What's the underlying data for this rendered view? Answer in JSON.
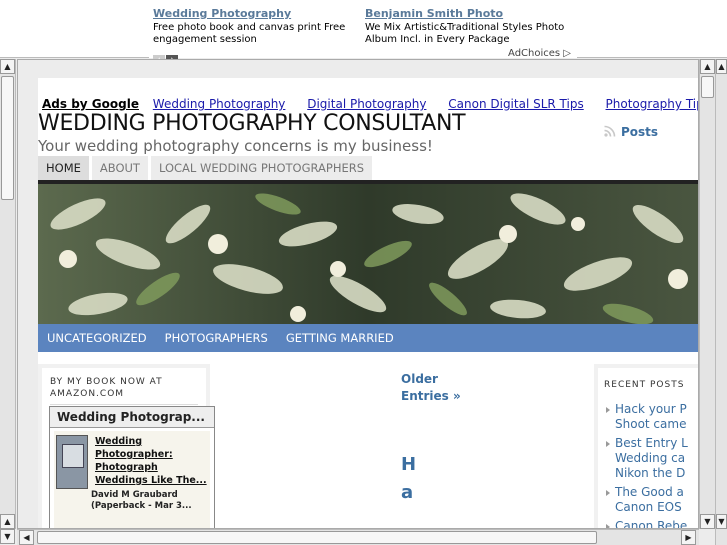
{
  "top_ad": {
    "units": [
      {
        "title": "Wedding Photography",
        "text": "Free photo book and canvas print Free engagement session"
      },
      {
        "title": "Benjamin Smith Photo",
        "text": "We Mix Artistic&Traditional Styles Photo Album Incl. in Every Package"
      }
    ],
    "prev_label": "‹",
    "next_label": "›",
    "adchoices": "AdChoices ▷"
  },
  "ad_links": {
    "label": "Ads by Google",
    "links": [
      "Wedding Photography",
      "Digital Photography",
      "Canon Digital SLR Tips",
      "Photography Tips"
    ]
  },
  "site": {
    "title": "WEDDING PHOTOGRAPHY CONSULTANT",
    "description": "Your wedding photography concerns is my business!",
    "posts_feed": "Posts"
  },
  "nav_tabs": [
    "HOME",
    "ABOUT",
    "LOCAL WEDDING PHOTOGRAPHERS"
  ],
  "categories": [
    "UNCATEGORIZED",
    "PHOTOGRAPHERS",
    "GETTING MARRIED"
  ],
  "left_sidebar": {
    "heading": "BY MY BOOK NOW AT AMAZON.COM",
    "widget_title": "Wedding Photograp...",
    "book_title": "Wedding Photographer: Photograph Weddings Like The...",
    "book_author": "David M Graubard",
    "book_format": "(Paperback - Mar 3..."
  },
  "main": {
    "older_entries": "Older Entries »",
    "post_title": "H a"
  },
  "right_sidebar": {
    "heading": "RECENT POSTS",
    "posts": [
      "Hack your P\nShoot came",
      "Best Entry L\nWedding ca\nNikon the D",
      "The Good a\nCanon EOS",
      "Canon Rebe"
    ]
  },
  "colors": {
    "accent_blue": "#5b84bf",
    "link_blue": "#3b6ea0",
    "ad_link": "#1a1aaa"
  }
}
